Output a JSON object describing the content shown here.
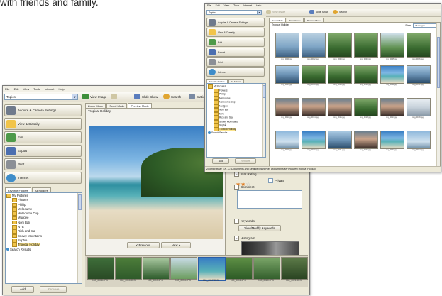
{
  "caption": "with friends and family.",
  "main_window": {
    "menu": [
      "File",
      "Edit",
      "View",
      "Tools",
      "Internet",
      "Help"
    ],
    "topic_combo": "Topics",
    "toolbar": {
      "view_image": "View Image",
      "slide_show": "Slide Show",
      "search": "Search",
      "extra": "Station"
    },
    "task_buttons": [
      "Acquire & Camera Settings",
      "View & Classify",
      "Edit",
      "Export",
      "Print",
      "Internet"
    ],
    "tree_tabs": [
      "Favorite Folders",
      "All Folders"
    ],
    "tree": [
      {
        "label": "My Pictures",
        "level": 0
      },
      {
        "label": "Flowers",
        "level": 1
      },
      {
        "label": "Phillip",
        "level": 1
      },
      {
        "label": "Melbourne",
        "level": 1
      },
      {
        "label": "Melbourne Cup",
        "level": 1
      },
      {
        "label": "Mudgee",
        "level": 1
      },
      {
        "label": "Noni Bali",
        "level": 1
      },
      {
        "label": "NYE",
        "level": 1
      },
      {
        "label": "Rich and Sia",
        "level": 1
      },
      {
        "label": "Snowy Mountains",
        "level": 1
      },
      {
        "label": "Sophie",
        "level": 1
      },
      {
        "label": "Tropical Holiday",
        "level": 1,
        "selected": true
      },
      {
        "label": "Search Results",
        "level": 0
      }
    ],
    "add_button": "Add",
    "remove_button": "Remove",
    "view_tabs": [
      "Zoom Mode",
      "Scroll Mode",
      "Preview Mode"
    ],
    "folder_title": "Tropical Holiday",
    "prev_button": "< Previous",
    "next_button": "Next >",
    "info": {
      "star_rating_label": "Star Rating",
      "rating": 2,
      "rating_max": 5,
      "private_label": "Private",
      "comment_label": "Comment",
      "keywords_label": "Keywords",
      "keywords_button": "View/Modify Keywords",
      "histogram_label": "Histogram"
    },
    "filmstrip": [
      "100_0008.JPG",
      "100_0010.JPG",
      "100_0013.JPG",
      "100_0014.JPG",
      "100_0017.JPG",
      "100_0018.JPG",
      "100_0020.JPG",
      "100_0021.JPG"
    ]
  },
  "back_window": {
    "menu": [
      "File",
      "Edit",
      "View",
      "Tools",
      "Internet",
      "Help"
    ],
    "topic_combo": "Topics",
    "toolbar": {
      "view_image": "View Image",
      "slide_show": "Slide Show",
      "search": "Search"
    },
    "task_buttons": [
      "Acquire & Camera Settings",
      "View & Classify",
      "Edit",
      "Export",
      "Print",
      "Internet"
    ],
    "tree_tabs": [
      "Favorite Folders",
      "All Folders"
    ],
    "tree": [
      {
        "label": "My Pictures",
        "level": 0
      },
      {
        "label": "Flowers",
        "level": 1
      },
      {
        "label": "Phillip",
        "level": 1
      },
      {
        "label": "Melbourne",
        "level": 1
      },
      {
        "label": "Melbourne Cup",
        "level": 1
      },
      {
        "label": "Mudgee",
        "level": 1
      },
      {
        "label": "Noni Bali",
        "level": 1
      },
      {
        "label": "NYE",
        "level": 1
      },
      {
        "label": "Rich and Sia",
        "level": 1
      },
      {
        "label": "Snowy Mountains",
        "level": 1
      },
      {
        "label": "Sophie",
        "level": 1
      },
      {
        "label": "Tropical Holiday",
        "level": 1,
        "selected": true
      },
      {
        "label": "Search Results",
        "level": 0
      }
    ],
    "add_button": "Add",
    "remove_button": "Remove",
    "view_tabs": [
      "Zoom Mode",
      "Scroll Mode",
      "Preview Mode"
    ],
    "folder_title": "Tropical Holiday",
    "show_label": "Show",
    "show_value": "All images",
    "status": "ZoomBrowser EX - C:\\Documents and Settings\\Owner\\My Documents\\My Pictures\\Tropical Holiday",
    "thumbnails": [
      {
        "caption": "img_0001.jpg",
        "scene": "ship"
      },
      {
        "caption": "img_0002.jpg",
        "scene": "ship"
      },
      {
        "caption": "img_0003.jpg",
        "scene": "forest"
      },
      {
        "caption": "img_0004.jpg",
        "scene": "forest"
      },
      {
        "caption": "img_0005.jpg",
        "scene": "palm"
      },
      {
        "caption": "img_0006.jpg",
        "scene": "forest"
      },
      {
        "caption": "img_0007.jpg",
        "scene": "lake"
      },
      {
        "caption": "img_0008.jpg",
        "scene": "forest"
      },
      {
        "caption": "img_0009.jpg",
        "scene": "forest"
      },
      {
        "caption": "img_0010.jpg",
        "scene": "forest"
      },
      {
        "caption": "img_0011.jpg",
        "scene": "beach"
      },
      {
        "caption": "img_0012.jpg",
        "scene": "lake"
      },
      {
        "caption": "img_0013.jpg",
        "scene": "people"
      },
      {
        "caption": "img_0014.jpg",
        "scene": "people"
      },
      {
        "caption": "img_0015.jpg",
        "scene": "people"
      },
      {
        "caption": "img_0016.jpg",
        "scene": "forest"
      },
      {
        "caption": "img_0017.jpg",
        "scene": "people"
      },
      {
        "caption": "img_0018.jpg",
        "scene": "sail"
      },
      {
        "caption": "img_0019.jpg",
        "scene": "sky"
      },
      {
        "caption": "img_0020.jpg",
        "scene": "beach"
      },
      {
        "caption": "img_0021.jpg",
        "scene": "lake"
      },
      {
        "caption": "img_0022.jpg",
        "scene": "people"
      },
      {
        "caption": "img_0023.jpg",
        "scene": "beach"
      },
      {
        "caption": "img_0024.jpg",
        "scene": "sky"
      }
    ]
  },
  "colors": {
    "window_bg": "#ece9d8",
    "selection": "#fbe38b",
    "accent_blue": "#7f9db9"
  }
}
